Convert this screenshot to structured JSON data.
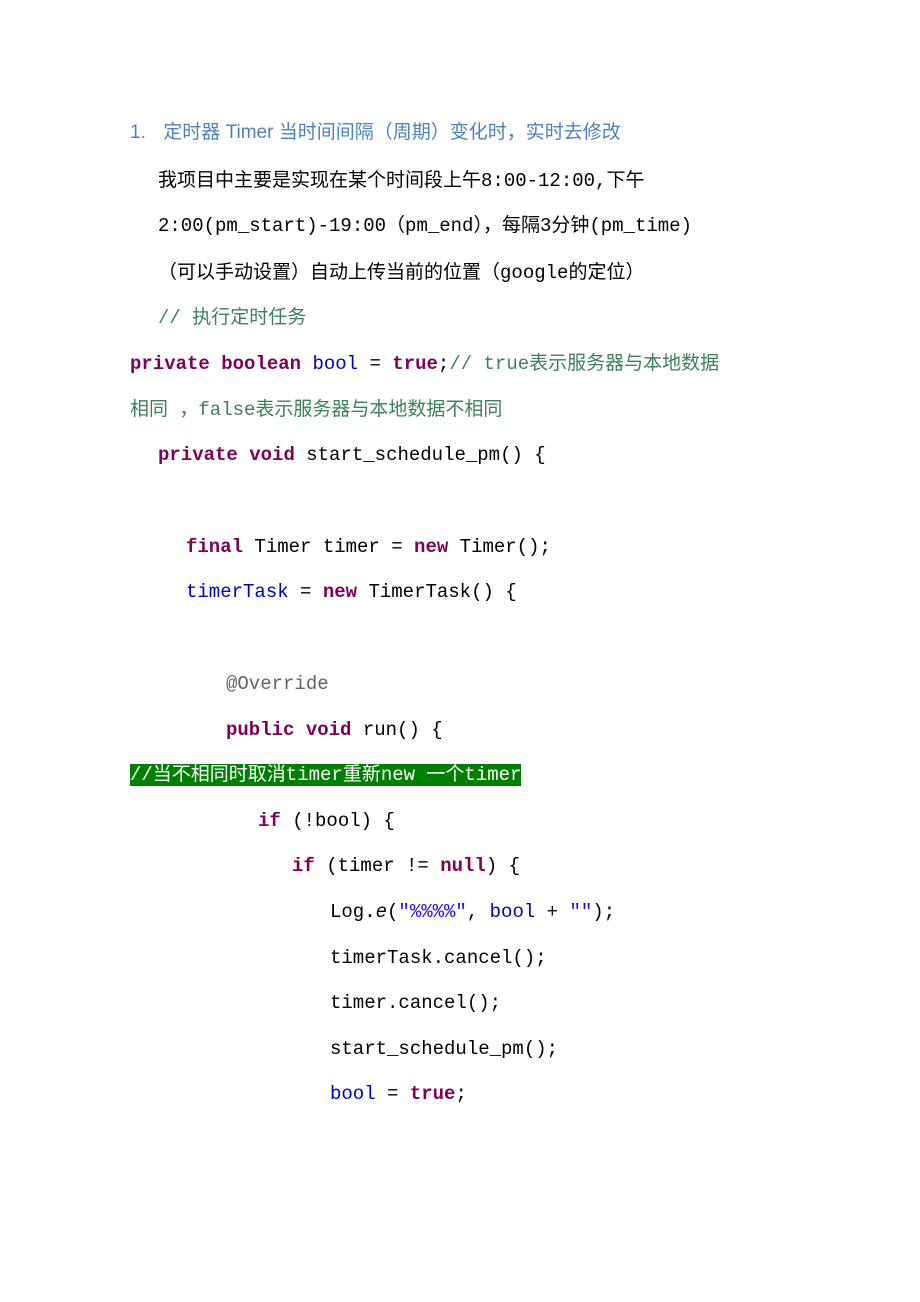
{
  "heading": {
    "number": "1.",
    "title_prefix": "定时器",
    "title_code": "Timer",
    "title_suffix": "当时间间隔（周期）变化时，实时去修改"
  },
  "intro": {
    "line1_prefix": "我项目中主要是实现在某个时间段上午",
    "line1_time": "8:00-12:00,",
    "line1_suffix": "下午",
    "line2": "2:00(pm_start)-19:00（pm_end），每隔3分钟(pm_time)",
    "line3_prefix": "（可以手动设置）自动上传当前的位置（",
    "line3_google": "google",
    "line3_suffix": "的定位）"
  },
  "code": {
    "c_exec": "// 执行定时任务",
    "kw_private": "private",
    "kw_boolean": "boolean",
    "fld_bool": "bool",
    "eq": " = ",
    "kw_true": "true",
    "semi": ";",
    "c_bool_1": "// true表示服务器与本地数据",
    "c_bool_2a": "相同 ，",
    "c_bool_2b": "false表示服务器与本地数据不相同",
    "kw_void": "void",
    "fn_start": "start_schedule_pm() {",
    "kw_final": "final",
    "ty_timer": " Timer timer = ",
    "kw_new": "new",
    "call_timer": " Timer();",
    "fld_timerTask": "timerTask",
    "call_timertask": " TimerTask() {",
    "ann_override": "@Override",
    "kw_public": "public",
    "fn_run": " run() {",
    "hl_comment": "//当不相同时取消timer重新new 一个timer",
    "kw_if": "if",
    "cond_notbool": " (!bool) {",
    "cond_timer_ne": " (timer != ",
    "kw_null": "null",
    "close_paren_brace": ") {",
    "log_e_pre": "Log.",
    "log_e_call": "e",
    "log_e_args_open": "(",
    "str_pct": "\"%%%%\"",
    "comma_sp": ", ",
    "plus_empty": " + ",
    "str_empty": "\"\"",
    "close_call": ");",
    "stmt_timerTask_cancel": "timerTask.cancel();",
    "stmt_timer_cancel": "timer.cancel();",
    "stmt_recurse": "start_schedule_pm();",
    "stmt_bool_true_lhs": "bool = ",
    "stmt_bool_true_rhs": "true",
    "stmt_bool_true_end": ";"
  }
}
